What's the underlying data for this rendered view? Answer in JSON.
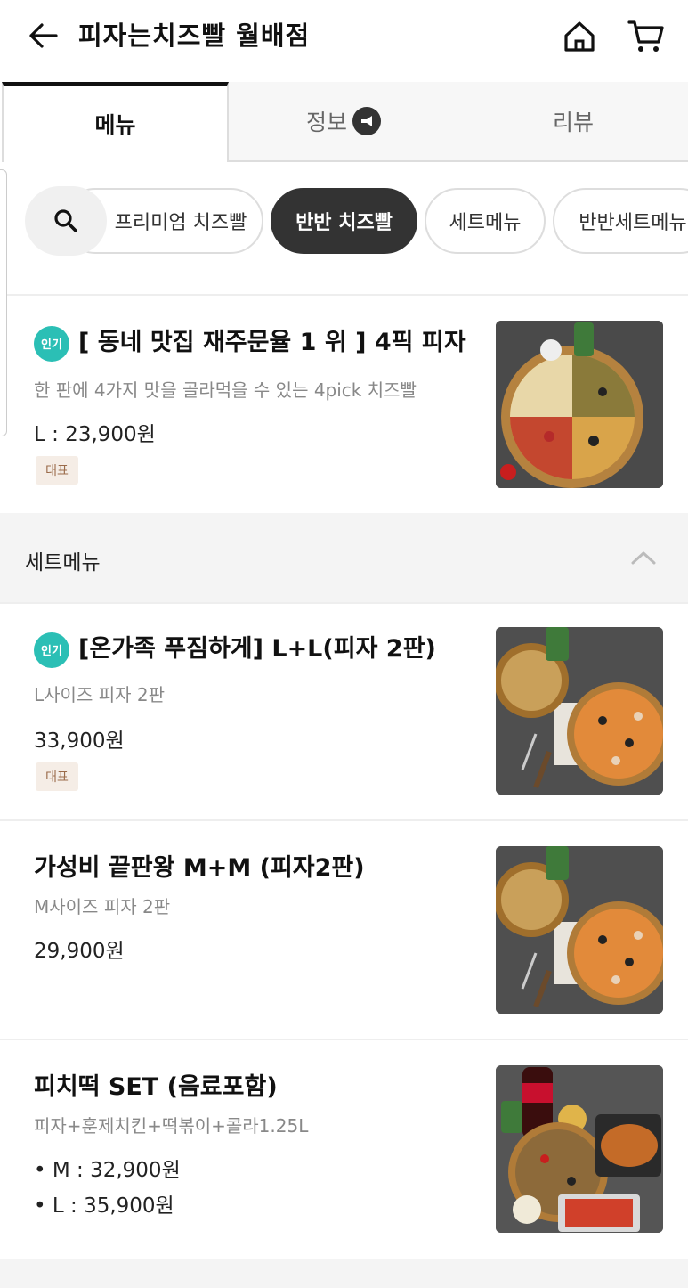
{
  "header": {
    "title": "피자는치즈빨 월배점"
  },
  "tabs": [
    {
      "label": "메뉴"
    },
    {
      "label": "정보"
    },
    {
      "label": "리뷰"
    }
  ],
  "chips": [
    {
      "label": "프리미엄 치즈빨"
    },
    {
      "label": "반반 치즈빨"
    },
    {
      "label": "세트메뉴"
    },
    {
      "label": "반반세트메뉴"
    }
  ],
  "items": [
    {
      "popular_badge": "인기",
      "name": "[ 동네 맛집 재주문율 1 위 ] 4픽 피자",
      "desc": "한 판에 4가지 맛을 골라먹을 수 있는 4pick 치즈빨",
      "price": "L : 23,900원",
      "tag": "대표"
    }
  ],
  "section": {
    "title": "세트메뉴"
  },
  "set_items": [
    {
      "popular_badge": "인기",
      "name": "[온가족 푸짐하게] L+L(피자 2판)",
      "desc": "L사이즈 피자 2판",
      "price": "33,900원",
      "tag": "대표"
    },
    {
      "name": "가성비 끝판왕 M+M (피자2판)",
      "desc": "M사이즈 피자 2판",
      "price": "29,900원"
    },
    {
      "name": "피치떡 SET (음료포함)",
      "desc": "피자+훈제치킨+떡볶이+콜라1.25L",
      "price_m": "• M : 32,900원",
      "price_l": "• L : 35,900원"
    }
  ],
  "colors": {
    "accent_badge": "#2bbfb5",
    "chip_active": "#333333",
    "tag_bg": "#f5ede6"
  }
}
